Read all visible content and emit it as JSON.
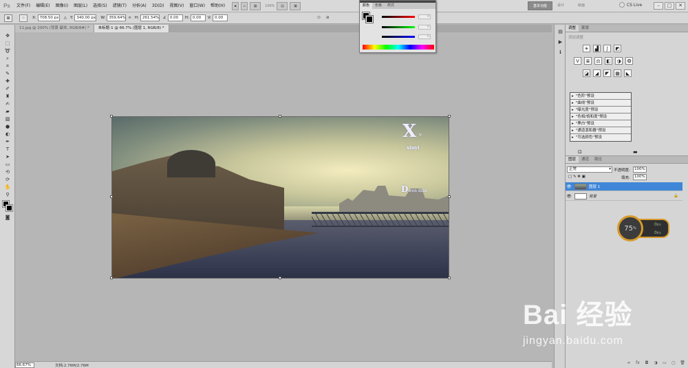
{
  "app": {
    "logo": "Ps"
  },
  "menu": [
    "文件(F)",
    "编辑(E)",
    "图像(I)",
    "图层(L)",
    "选择(S)",
    "滤镜(T)",
    "分析(A)",
    "3D(D)",
    "视图(V)",
    "窗口(W)",
    "帮助(H)"
  ],
  "menubar": {
    "zoom": "100%",
    "workspace": "基本功能",
    "ws2": "设计",
    "ws3": "绘画",
    "cslive": "CS Live"
  },
  "options": {
    "x_label": "X:",
    "x_value": "708.50 px",
    "y_label": "Y:",
    "y_value": "340.00 px",
    "w_label": "W:",
    "w_value": "359.64%",
    "h_label": "H:",
    "h_value": "261.54%",
    "angle_value": "0.00",
    "hskew_label": "H:",
    "hskew_value": "0.00",
    "vskew_label": "V:",
    "vskew_value": "0.00"
  },
  "tabs": [
    {
      "label": "11.jpg @ 200% (背景 副本, RGB/8#) *"
    },
    {
      "label": "未标题-1 @ 66.7% (图层 1, RGB/8) *"
    }
  ],
  "photo": {
    "watermark_x": "X",
    "watermark_v": "v",
    "watermark_xinyi": "xinyi",
    "watermark_d": "D",
    "watermark_d_rest": "wen dian"
  },
  "status": {
    "zoom": "66.67%",
    "doc": "文档:2.76M/2.76M"
  },
  "color_panel": {
    "tabs": [
      "颜色",
      "色板",
      "样式"
    ],
    "r": "0",
    "g": "0",
    "b": "0"
  },
  "adjustments": {
    "tabs": [
      "调整",
      "蒙版"
    ],
    "title": "添加调整",
    "presets": [
      "\"色阶\"预设",
      "\"曲线\"预设",
      "\"曝光度\"预设",
      "\"色相/饱和度\"预设",
      "\"黑白\"预设",
      "\"通道混和器\"预设",
      "\"可选颜色\"预设"
    ]
  },
  "layers": {
    "tabs": [
      "图层",
      "通道",
      "路径"
    ],
    "blend": "正常",
    "opacity_label": "不透明度:",
    "opacity": "100%",
    "fill_label": "填充:",
    "fill": "100%",
    "items": [
      {
        "name": "图层 1"
      },
      {
        "name": "背景"
      }
    ]
  },
  "speed": {
    "percent": "75",
    "unit": "%",
    "up": "0",
    "up_unit": "K/s",
    "down": "0",
    "down_unit": "K/s"
  },
  "watermark": {
    "logo": "Bai 经验",
    "url": "jingyan.baidu.com"
  }
}
